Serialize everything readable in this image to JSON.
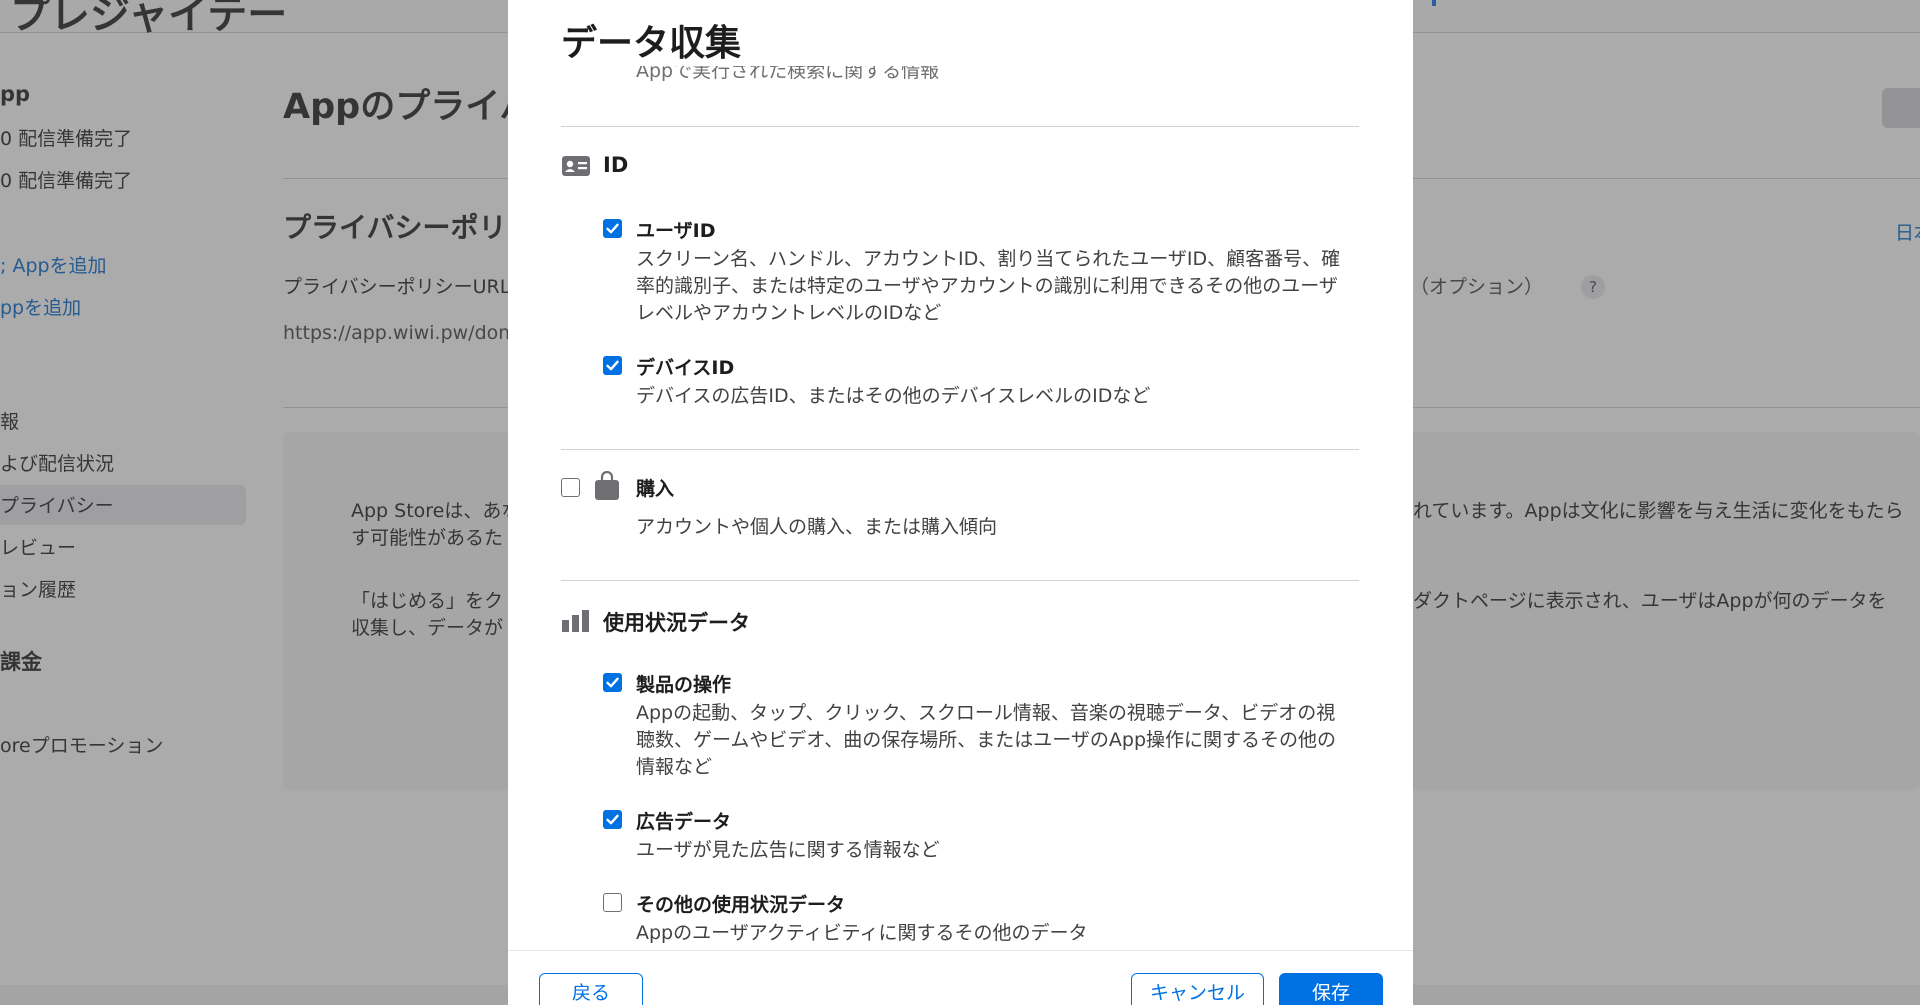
{
  "background": {
    "app_title": "プレジャイテー",
    "sidebar": [
      {
        "label": "pp",
        "style": "bold"
      },
      {
        "label": "0 配信準備完了",
        "style": "normal"
      },
      {
        "label": "0 配信準備完了",
        "style": "normal"
      },
      {
        "label": "; Appを追加",
        "style": "link"
      },
      {
        "label": "ppを追加",
        "style": "link"
      },
      {
        "label": "報",
        "style": "normal"
      },
      {
        "label": "よび配信状況",
        "style": "normal"
      },
      {
        "label": "プライバシー",
        "style": "normal",
        "selected": true
      },
      {
        "label": "レビュー",
        "style": "normal"
      },
      {
        "label": "ョン履歴",
        "style": "normal"
      },
      {
        "label": "課金",
        "style": "bold"
      },
      {
        "label": "oreプロモーション",
        "style": "normal"
      }
    ],
    "main_title": "Appのプライバ",
    "section_title": "プライバシーポリ",
    "policy_url_label": "プライバシーポリシーURL",
    "policy_url_value": "https://app.wiwi.pw/domi",
    "optional_label": "（オプション）",
    "help_label": "?",
    "language_link": "日本",
    "info_lines": [
      "App Storeは、あな",
      "す可能性があるた",
      "「はじめる」をク",
      "収集し、データが",
      "れています。Appは文化に影響を与え生活に変化をもたら",
      "ダクトページに表示され、ユーザはAppが何のデータを"
    ]
  },
  "modal": {
    "title": "データ収集",
    "cut_off_text": "Appで実行された検索に関する情報",
    "categories": [
      {
        "icon": "id-card-icon",
        "title": "ID",
        "has_checkbox": false,
        "items": [
          {
            "title": "ユーザID",
            "checked": true,
            "description": [
              "スクリーン名、ハンドル、アカウントID、割り当てられたユーザID、顧客番号、確",
              "率的識別子、または特定のユーザやアカウントの識別に利用できるその他のユーザ",
              "レベルやアカウントレベルのIDなど"
            ]
          },
          {
            "title": "デバイスID",
            "checked": true,
            "description": [
              "デバイスの広告ID、またはその他のデバイスレベルのIDなど"
            ]
          }
        ]
      },
      {
        "icon": "shopping-bag-icon",
        "title": "購入",
        "has_checkbox": true,
        "checked": false,
        "description": [
          "アカウントや個人の購入、または購入傾向"
        ],
        "items": []
      },
      {
        "icon": "bar-chart-icon",
        "title": "使用状況データ",
        "has_checkbox": false,
        "items": [
          {
            "title": "製品の操作",
            "checked": true,
            "description": [
              "Appの起動、タップ、クリック、スクロール情報、音楽の視聴データ、ビデオの視",
              "聴数、ゲームやビデオ、曲の保存場所、またはユーザのApp操作に関するその他の",
              "情報など"
            ]
          },
          {
            "title": "広告データ",
            "checked": true,
            "description": [
              "ユーザが見た広告に関する情報など"
            ]
          },
          {
            "title": "その他の使用状況データ",
            "checked": false,
            "description": [
              "Appのユーザアクティビティに関するその他のデータ"
            ]
          }
        ]
      }
    ],
    "buttons": {
      "back": "戻る",
      "cancel": "キャンセル",
      "save": "保存"
    },
    "colors": {
      "accent": "#0071e3",
      "checkbox_on": "#0071e3",
      "overlay": "rgba(80,80,80,0.48)"
    }
  }
}
